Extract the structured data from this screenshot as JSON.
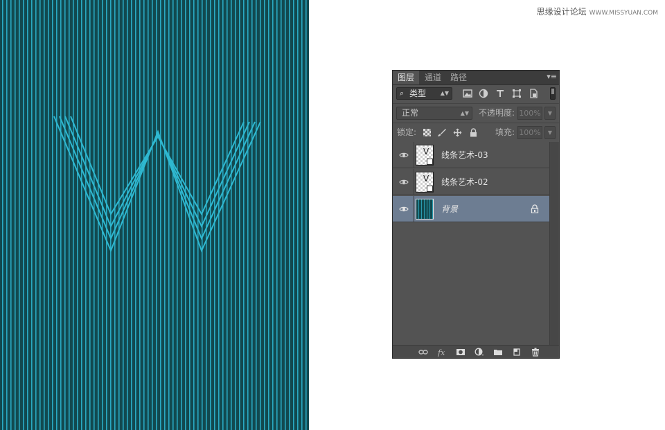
{
  "watermark": {
    "site_name": "思缘设计论坛",
    "url": "WWW.MISSYUAN.COM"
  },
  "colors": {
    "canvas_bg": "#12494f",
    "stripe": "#29a9c2",
    "panel_bg": "#535353",
    "selected_row": "#6d7d92"
  },
  "canvas": {
    "letter": "W"
  },
  "layers_panel": {
    "tabs": [
      {
        "label": "图层",
        "active": true
      },
      {
        "label": "通道",
        "active": false
      },
      {
        "label": "路径",
        "active": false
      }
    ],
    "filter": {
      "search_icon": "search-icon",
      "kind_label": "类型",
      "icons": [
        "pixel-filter-icon",
        "adjustment-filter-icon",
        "type-filter-icon",
        "shape-filter-icon",
        "smart-object-filter-icon"
      ]
    },
    "blend_mode": "正常",
    "opacity_label": "不透明度:",
    "opacity_value": "100%",
    "lock_label": "锁定:",
    "fill_label": "填充:",
    "fill_value": "100%",
    "layers": [
      {
        "name": "线条艺术-03",
        "visible": true,
        "selected": false,
        "smart_object": true,
        "locked": false
      },
      {
        "name": "线条艺术-02",
        "visible": true,
        "selected": false,
        "smart_object": true,
        "locked": false
      },
      {
        "name": "背景",
        "visible": true,
        "selected": true,
        "smart_object": false,
        "locked": true
      }
    ],
    "bottom_icons": [
      "link-layers-icon",
      "fx-icon",
      "layer-mask-icon",
      "adjustment-layer-icon",
      "new-group-icon",
      "new-layer-icon",
      "delete-layer-icon"
    ]
  }
}
